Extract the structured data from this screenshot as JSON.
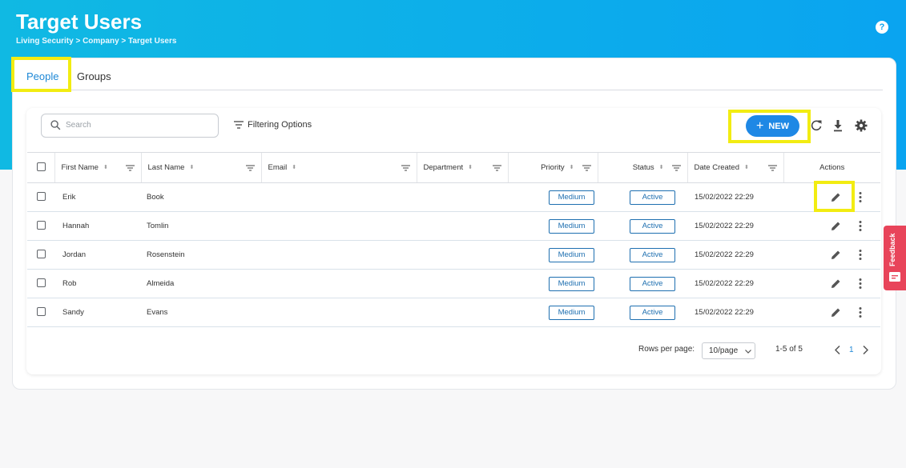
{
  "header": {
    "title": "Target Users",
    "breadcrumb": "Living Security > Company > Target Users",
    "help_label": "?"
  },
  "tabs": [
    {
      "label": "People",
      "active": true
    },
    {
      "label": "Groups",
      "active": false
    }
  ],
  "toolbar": {
    "search_placeholder": "Search",
    "filter_label": "Filtering Options",
    "new_label": "NEW"
  },
  "table": {
    "columns": [
      "First Name",
      "Last Name",
      "Email",
      "Department",
      "Priority",
      "Status",
      "Date Created",
      "Actions"
    ],
    "rows": [
      {
        "first": "Erik",
        "last": "Book",
        "email": "",
        "department": "",
        "priority": "Medium",
        "status": "Active",
        "date": "15/02/2022 22:29"
      },
      {
        "first": "Hannah",
        "last": "Tomlin",
        "email": "",
        "department": "",
        "priority": "Medium",
        "status": "Active",
        "date": "15/02/2022 22:29"
      },
      {
        "first": "Jordan",
        "last": "Rosenstein",
        "email": "",
        "department": "",
        "priority": "Medium",
        "status": "Active",
        "date": "15/02/2022 22:29"
      },
      {
        "first": "Rob",
        "last": "Almeida",
        "email": "",
        "department": "",
        "priority": "Medium",
        "status": "Active",
        "date": "15/02/2022 22:29"
      },
      {
        "first": "Sandy",
        "last": "Evans",
        "email": "",
        "department": "",
        "priority": "Medium",
        "status": "Active",
        "date": "15/02/2022 22:29"
      }
    ]
  },
  "pagination": {
    "rows_per_page_label": "Rows per page:",
    "rows_per_page_value": "10/page",
    "range": "1-5 of 5",
    "current_page": "1"
  },
  "feedback": {
    "label": "Feedback"
  },
  "colors": {
    "accent": "#1e88e5",
    "banner": "#10b9e3",
    "highlight": "#f2ec12",
    "feedback": "#e8445a"
  }
}
